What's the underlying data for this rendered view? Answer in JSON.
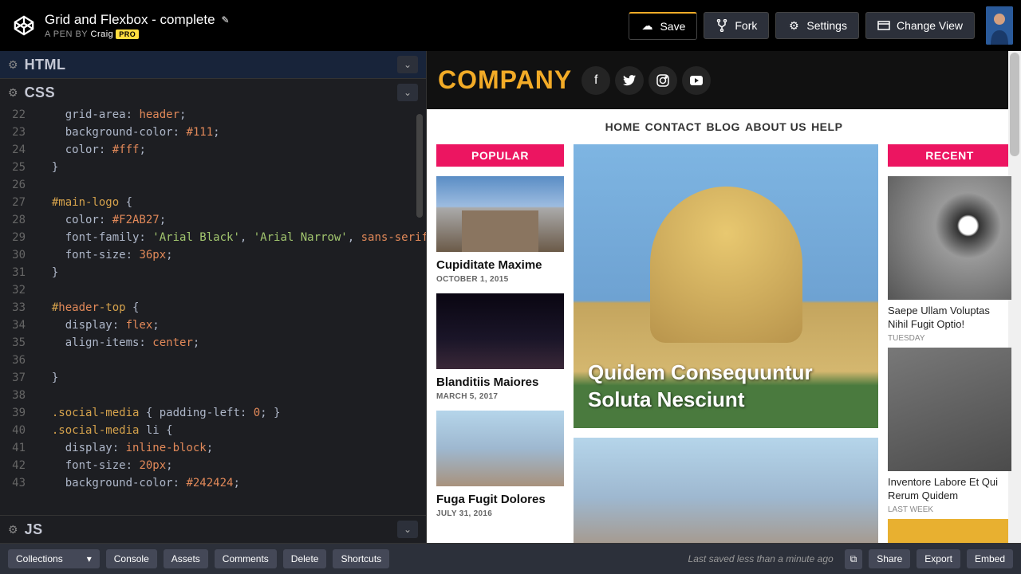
{
  "header": {
    "pen_title": "Grid and Flexbox - complete",
    "byline_prefix": "A PEN BY",
    "author": "Craig",
    "pro_badge": "PRO",
    "buttons": {
      "save": "Save",
      "fork": "Fork",
      "settings": "Settings",
      "change_view": "Change View"
    }
  },
  "panels": {
    "html": "HTML",
    "css": "CSS",
    "js": "JS"
  },
  "code": {
    "lines": [
      {
        "n": "22",
        "t": "    grid-area: header;"
      },
      {
        "n": "23",
        "t": "    background-color: #111;"
      },
      {
        "n": "24",
        "t": "    color: #fff;"
      },
      {
        "n": "25",
        "t": "  }"
      },
      {
        "n": "26",
        "t": ""
      },
      {
        "n": "27",
        "t": "  #main-logo {"
      },
      {
        "n": "28",
        "t": "    color: #F2AB27;"
      },
      {
        "n": "29",
        "t": "    font-family: 'Arial Black', 'Arial Narrow', sans-serif;"
      },
      {
        "n": "30",
        "t": "    font-size: 36px;"
      },
      {
        "n": "31",
        "t": "  }"
      },
      {
        "n": "32",
        "t": ""
      },
      {
        "n": "33",
        "t": "  #header-top {"
      },
      {
        "n": "34",
        "t": "    display: flex;"
      },
      {
        "n": "35",
        "t": "    align-items: center;"
      },
      {
        "n": "36",
        "t": "    "
      },
      {
        "n": "37",
        "t": "  }"
      },
      {
        "n": "38",
        "t": ""
      },
      {
        "n": "39",
        "t": "  .social-media { padding-left: 0; }"
      },
      {
        "n": "40",
        "t": "  .social-media li {"
      },
      {
        "n": "41",
        "t": "    display: inline-block;"
      },
      {
        "n": "42",
        "t": "    font-size: 20px;"
      },
      {
        "n": "43",
        "t": "    background-color: #242424;"
      }
    ]
  },
  "preview": {
    "logo": "COMPANY",
    "nav": [
      "HOME",
      "CONTACT",
      "BLOG",
      "ABOUT US",
      "HELP"
    ],
    "popular": {
      "title": "POPULAR",
      "items": [
        {
          "title": "Cupiditate Maxime",
          "date": "OCTOBER 1, 2015"
        },
        {
          "title": "Blanditiis Maiores",
          "date": "MARCH 5, 2017"
        },
        {
          "title": "Fuga Fugit Dolores",
          "date": "JULY 31, 2016"
        }
      ]
    },
    "hero": "Quidem Consequuntur Soluta Nesciunt",
    "recent": {
      "title": "RECENT",
      "items": [
        {
          "title": "Saepe Ullam Voluptas Nihil Fugit Optio!",
          "date": "TUESDAY"
        },
        {
          "title": "Inventore Labore Et Qui Rerum Quidem",
          "date": "LAST WEEK"
        }
      ]
    }
  },
  "footer": {
    "collections": "Collections",
    "console": "Console",
    "assets": "Assets",
    "comments": "Comments",
    "delete": "Delete",
    "shortcuts": "Shortcuts",
    "status": "Last saved less than a minute ago",
    "share": "Share",
    "export": "Export",
    "embed": "Embed"
  }
}
